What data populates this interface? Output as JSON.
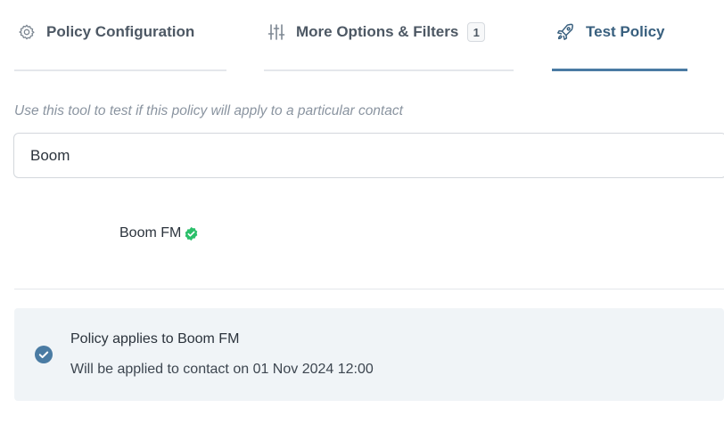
{
  "tabs": [
    {
      "label": "Policy Configuration",
      "icon": "gear-icon"
    },
    {
      "label": "More Options & Filters",
      "icon": "sliders-icon",
      "badge": "1"
    },
    {
      "label": "Test Policy",
      "icon": "rocket-icon",
      "active": true
    }
  ],
  "test": {
    "hint": "Use this tool to test if this policy will apply to a particular contact",
    "search_value": "Boom",
    "result_name": "Boom FM"
  },
  "status": {
    "title": "Policy applies to Boom FM",
    "subtitle": "Will be applied to contact on 01 Nov 2024 12:00"
  },
  "colors": {
    "accent": "#4a7ba3",
    "success": "#2bbf6a",
    "panel_bg": "#f0f4f7"
  }
}
